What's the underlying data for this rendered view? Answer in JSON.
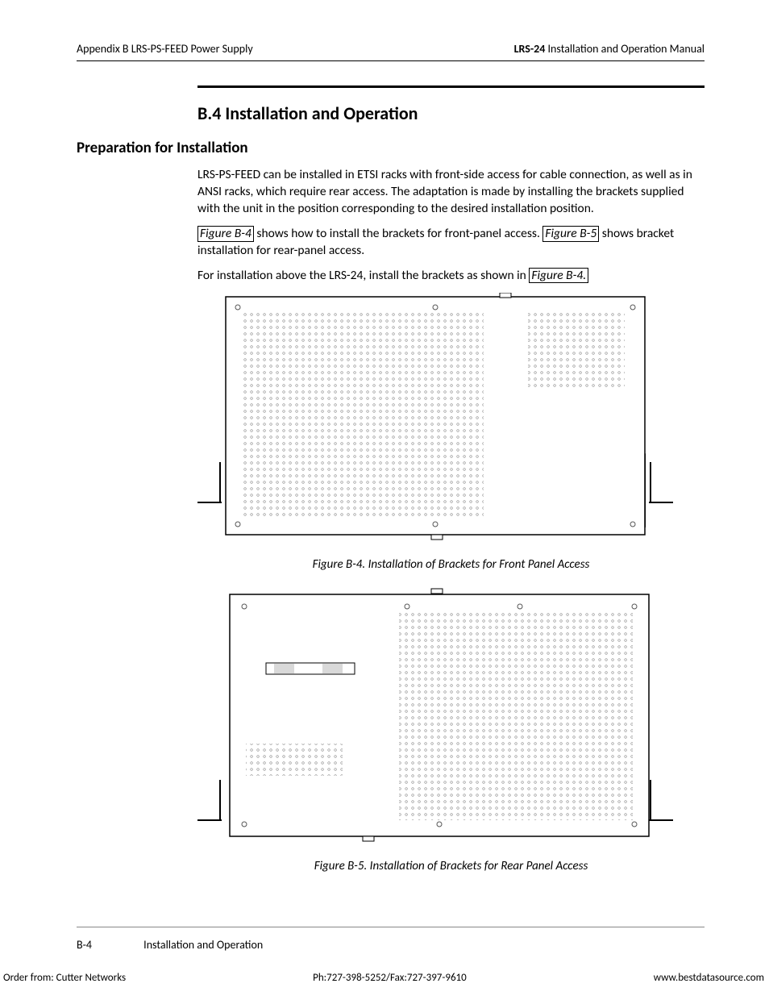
{
  "header": {
    "left": "Appendix B  LRS-PS-FEED Power Supply",
    "right_bold": "LRS-24",
    "right_rest": " Installation and Operation Manual"
  },
  "title": "B.4  Installation and Operation",
  "subtitle": "Preparation for Installation",
  "para1": "LRS-PS-FEED can be installed in ETSI racks with front-side access for cable connection, as well as in ANSI racks, which require rear access. The adaptation is made by installing the brackets supplied with the unit in the position corresponding to the desired installation position.",
  "para2a": "Figure B-4",
  "para2b": " shows how to install the brackets for front-panel access. ",
  "para2c": "Figure B-5",
  "para2d": " shows bracket installation for rear-panel access.",
  "para3a": "For installation above the LRS-24, install the brackets as shown in ",
  "para3b": "Figure B-4.",
  "cap1": "Figure B-4.  Installation of Brackets for Front Panel Access",
  "cap2": "Figure B-5.  Installation of Brackets for Rear Panel Access",
  "footer": {
    "pagenum": "B-4",
    "section": "Installation and Operation",
    "order": "Order from: Cutter Networks",
    "phone": "Ph:727-398-5252/Fax:727-397-9610",
    "url": "www.bestdatasource.com"
  }
}
